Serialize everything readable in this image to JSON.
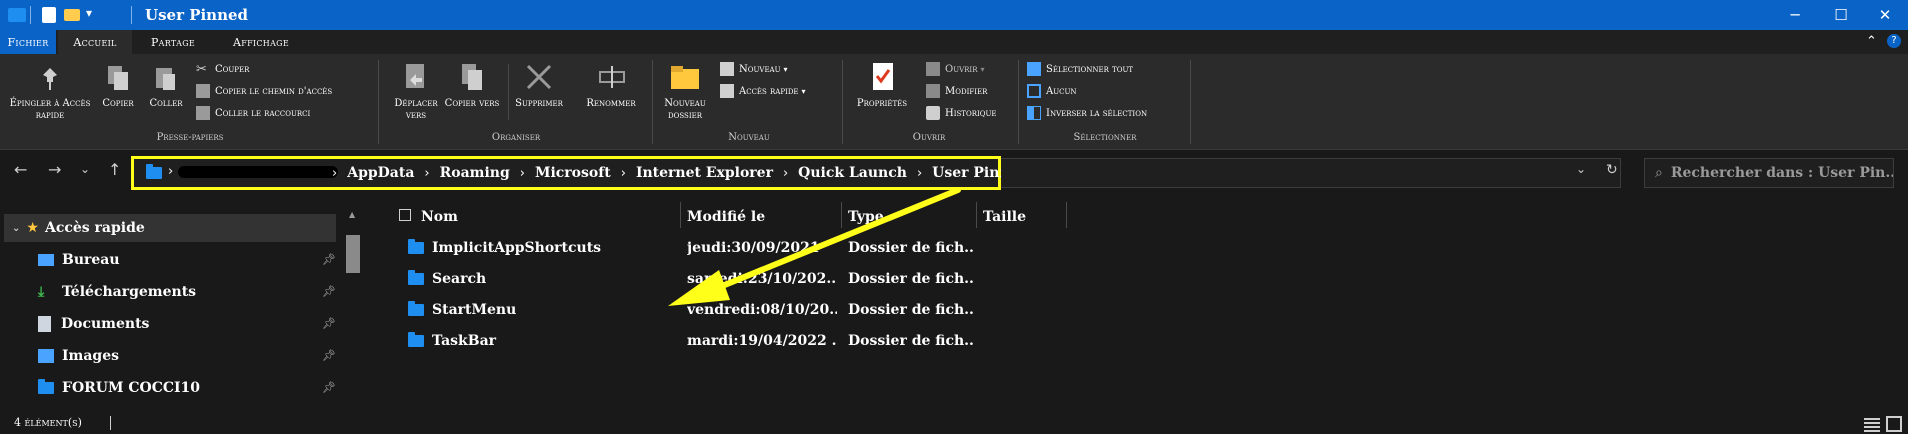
{
  "window": {
    "title": "User Pinned",
    "minimize_glyph": "─",
    "maximize_glyph": "☐",
    "close_glyph": "✕"
  },
  "ribbon_tabs": [
    "Fichier",
    "Accueil",
    "Partage",
    "Affichage"
  ],
  "ribbon": {
    "presse_papiers": {
      "label": "Presse-papiers",
      "pin": "Épingler à Accès rapide",
      "copy": "Copier",
      "paste": "Coller",
      "cut": "Couper",
      "copy_path": "Copier le chemin d'accès",
      "paste_shortcut": "Coller le raccourci"
    },
    "organiser": {
      "label": "Organiser",
      "move_to": "Déplacer vers",
      "copy_to": "Copier vers",
      "delete": "Supprimer",
      "rename": "Renommer"
    },
    "nouveau": {
      "label": "Nouveau",
      "new_folder": "Nouveau dossier",
      "new_item": "Nouveau",
      "easy_access": "Accès rapide"
    },
    "ouvrir": {
      "label": "Ouvrir",
      "properties": "Propriétés",
      "open": "Ouvrir",
      "edit": "Modifier",
      "history": "Historique"
    },
    "selectionner": {
      "label": "Sélectionner",
      "select_all": "Sélectionner tout",
      "select_none": "Aucun",
      "invert": "Inverser la sélection"
    }
  },
  "address": {
    "breadcrumb": [
      "AppData",
      "Roaming",
      "Microsoft",
      "Internet Explorer",
      "Quick Launch",
      "User Pinned"
    ],
    "search_placeholder": "Rechercher dans : User Pin..."
  },
  "nav": {
    "quick_access": "Accès rapide",
    "items": [
      {
        "label": "Bureau",
        "icon": "desktop-icon",
        "pinned": true
      },
      {
        "label": "Téléchargements",
        "icon": "download-icon",
        "pinned": true
      },
      {
        "label": "Documents",
        "icon": "document-icon",
        "pinned": true
      },
      {
        "label": "Images",
        "icon": "image-icon",
        "pinned": true
      },
      {
        "label": "FORUM COCCI10",
        "icon": "folder-icon",
        "pinned": true
      }
    ]
  },
  "columns": [
    "Nom",
    "Modifié le",
    "Type",
    "Taille"
  ],
  "files": [
    {
      "name": "ImplicitAppShortcuts",
      "modified": "jeudi:30/09/2021",
      "type": "Dossier de fich..."
    },
    {
      "name": "Search",
      "modified": "samedi:23/10/202...",
      "type": "Dossier de fich..."
    },
    {
      "name": "StartMenu",
      "modified": "vendredi:08/10/20...",
      "type": "Dossier de fich..."
    },
    {
      "name": "TaskBar",
      "modified": "mardi:19/04/2022 ...",
      "type": "Dossier de fich..."
    }
  ],
  "status": {
    "count": "4 élément(s)"
  },
  "annotation": {
    "highlight_color": "#ffff1a",
    "arrow_color": "#ffff1a"
  },
  "colors": {
    "accent": "#0a63c6",
    "folder": "#1e8ff0",
    "background": "#191919"
  }
}
